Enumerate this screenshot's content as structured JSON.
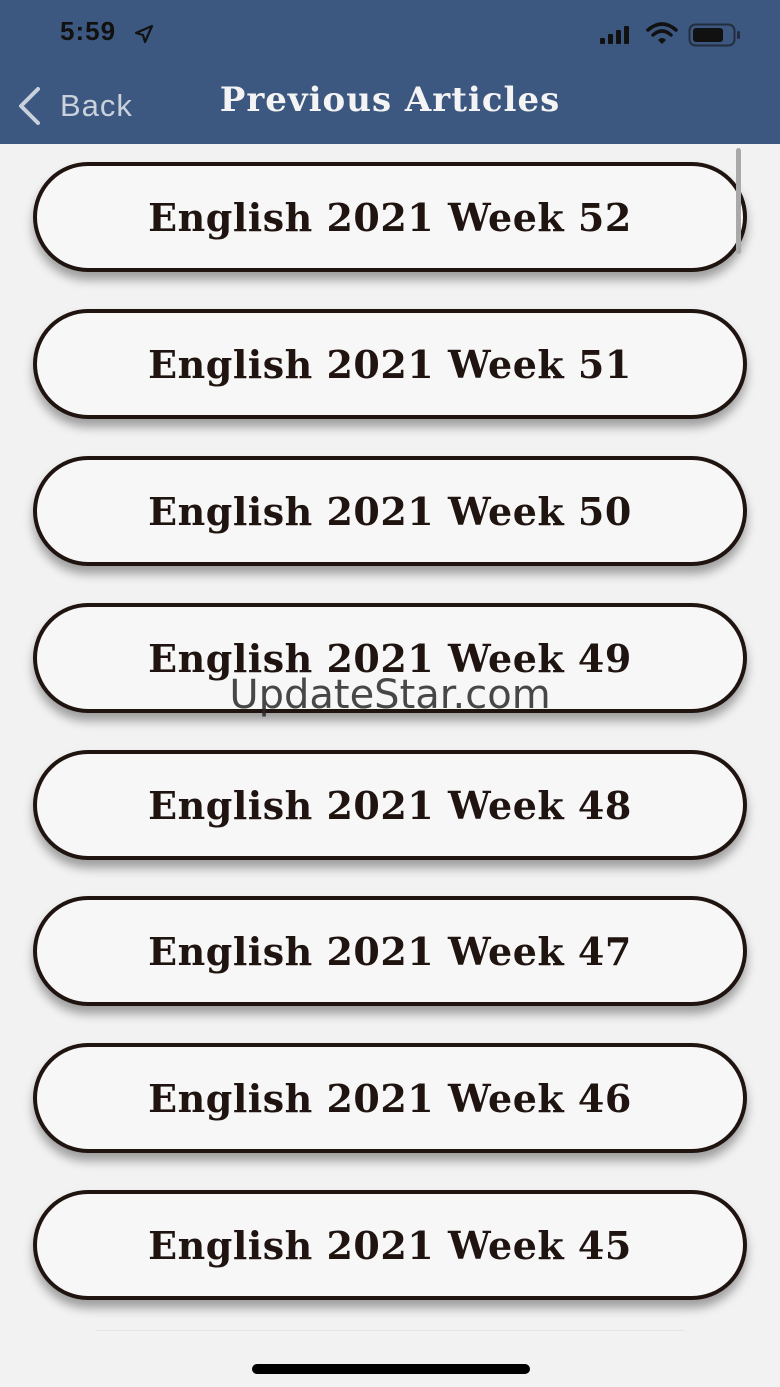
{
  "status_bar": {
    "time": "5:59"
  },
  "nav": {
    "back_label": "Back",
    "title": "Previous Articles"
  },
  "articles": [
    {
      "label": "English 2021 Week 52"
    },
    {
      "label": "English 2021 Week 51"
    },
    {
      "label": "English 2021 Week 50"
    },
    {
      "label": "English 2021 Week 49"
    },
    {
      "label": "English 2021 Week 48"
    },
    {
      "label": "English 2021 Week 47"
    },
    {
      "label": "English 2021 Week 46"
    },
    {
      "label": "English 2021 Week 45"
    }
  ],
  "watermark": "UpdateStar.com",
  "colors": {
    "nav_background": "#3d5880",
    "page_background": "#f2f2f2",
    "button_border": "#1f1410"
  },
  "icons": {
    "location": "location-arrow-icon",
    "signal": "cellular-signal-icon",
    "wifi": "wifi-icon",
    "battery": "battery-icon",
    "back": "chevron-left-icon"
  }
}
